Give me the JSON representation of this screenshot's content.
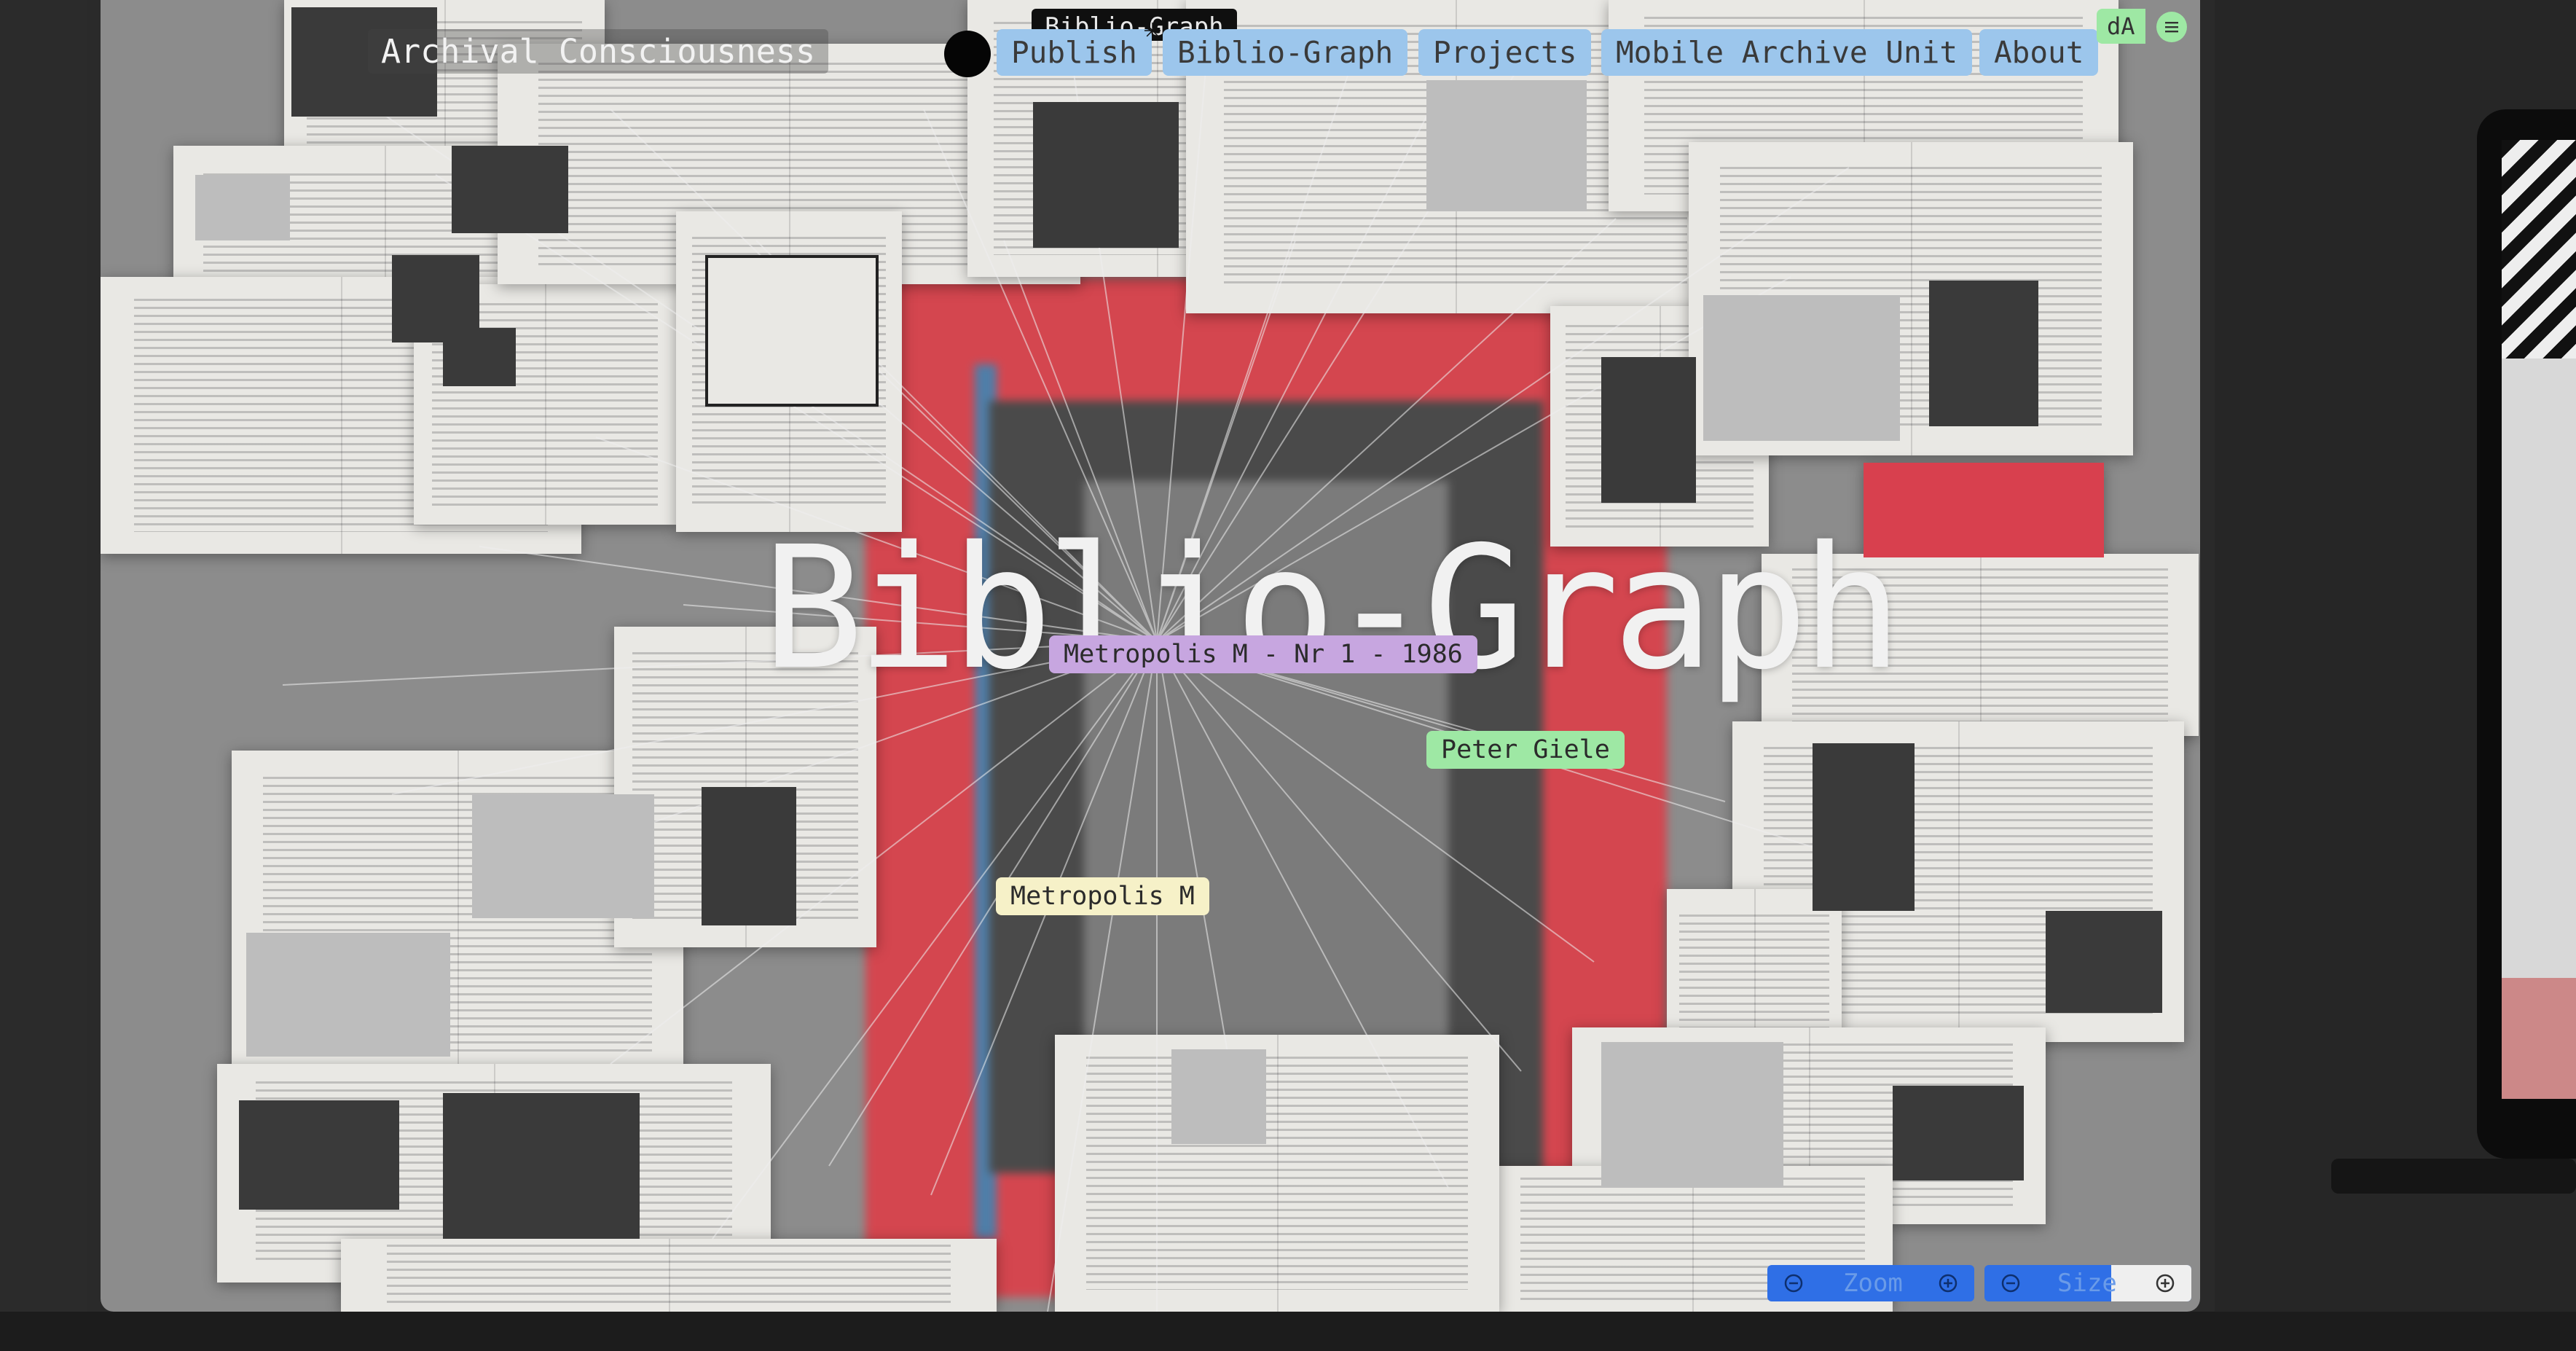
{
  "site": {
    "brand": "Archival Consciousness",
    "tooltip": "Biblio-Graph",
    "nav": [
      {
        "label": "Publish"
      },
      {
        "label": "Biblio-Graph"
      },
      {
        "label": "Projects"
      },
      {
        "label": "Mobile Archive Unit"
      },
      {
        "label": "About"
      }
    ],
    "da_label": "dA",
    "menu_icon": "hamburger-icon"
  },
  "canvas": {
    "title": "Biblio-Graph",
    "nodes": [
      {
        "label": "Metropolis M - Nr 1 - 1986",
        "color": "#c7a6e0"
      },
      {
        "label": "Peter Giele",
        "color": "#9ee8a4"
      },
      {
        "label": "Metropolis M",
        "color": "#f6f1c8"
      }
    ]
  },
  "controls": {
    "zoom_label": "Zoom",
    "size_label": "Size",
    "minus_icon": "minus-circle-icon",
    "plus_icon": "plus-circle-icon"
  },
  "colors": {
    "nav_bg": "#9cc6ec",
    "accent_blue": "#2f6fe6",
    "accent_green": "#9ee8a4"
  }
}
